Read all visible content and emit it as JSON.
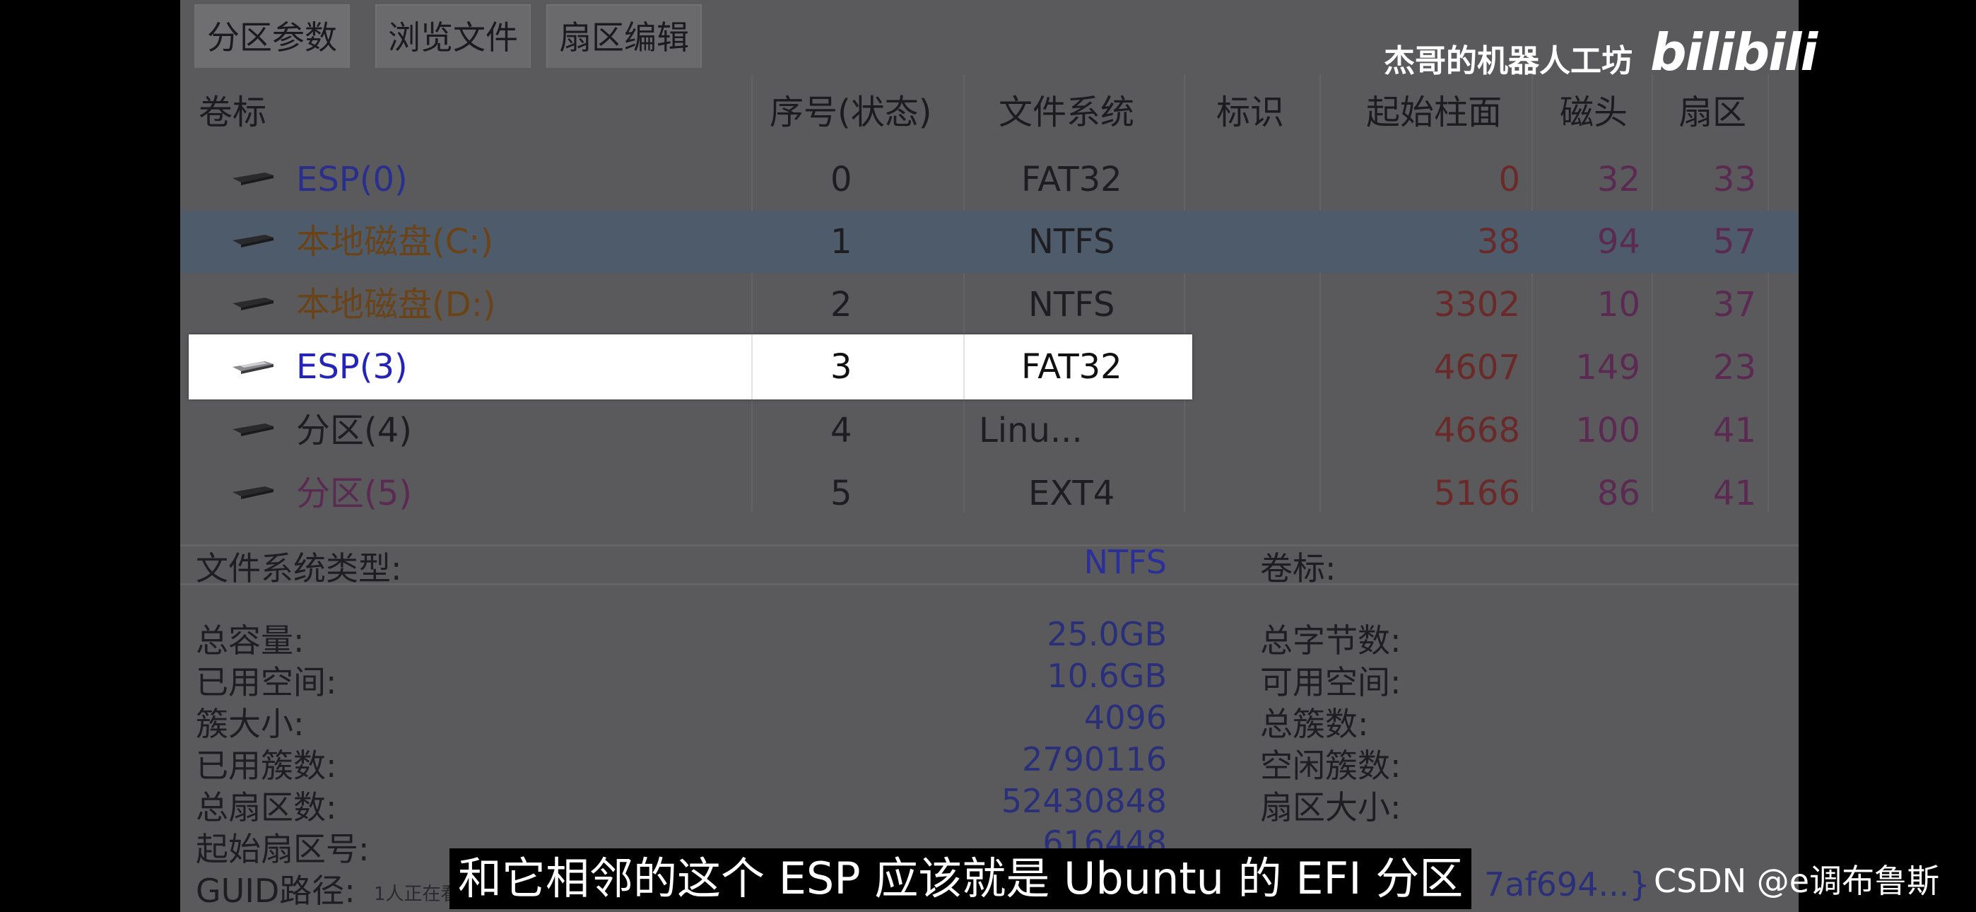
{
  "tabs": [
    {
      "label": "分区参数"
    },
    {
      "label": "浏览文件"
    },
    {
      "label": "扇区编辑"
    }
  ],
  "columns": {
    "label": "卷标",
    "index": "序号(状态)",
    "fs": "文件系统",
    "id": "标识",
    "cyl": "起始柱面",
    "head": "磁头",
    "sector": "扇区"
  },
  "partitions": [
    {
      "label": "ESP(0)",
      "index": "0",
      "fs": "FAT32",
      "cyl": "0",
      "head": "32",
      "sector": "33"
    },
    {
      "label": "本地磁盘(C:)",
      "index": "1",
      "fs": "NTFS",
      "cyl": "38",
      "head": "94",
      "sector": "57"
    },
    {
      "label": "本地磁盘(D:)",
      "index": "2",
      "fs": "NTFS",
      "cyl": "3302",
      "head": "10",
      "sector": "37"
    },
    {
      "label": "ESP(3)",
      "index": "3",
      "fs": "FAT32",
      "cyl": "4607",
      "head": "149",
      "sector": "23"
    },
    {
      "label": "分区(4)",
      "index": "4",
      "fs": "Linu...",
      "cyl": "4668",
      "head": "100",
      "sector": "41"
    },
    {
      "label": "分区(5)",
      "index": "5",
      "fs": "EXT4",
      "cyl": "5166",
      "head": "86",
      "sector": "41"
    }
  ],
  "info": {
    "fs_type_label": "文件系统类型:",
    "fs_type_value": "NTFS",
    "volume_label": "卷标:",
    "left": [
      {
        "label": "总容量:",
        "value": "25.0GB"
      },
      {
        "label": "已用空间:",
        "value": "10.6GB"
      },
      {
        "label": "簇大小:",
        "value": "4096"
      },
      {
        "label": "已用簇数:",
        "value": "2790116"
      },
      {
        "label": "总扇区数:",
        "value": "52430848"
      },
      {
        "label": "起始扇区号:",
        "value": "616448"
      },
      {
        "label": "GUID路径:",
        "value": ""
      }
    ],
    "right": [
      {
        "label": "总字节数:"
      },
      {
        "label": "可用空间:"
      },
      {
        "label": "总簇数:"
      },
      {
        "label": "空闲簇数:"
      },
      {
        "label": "扇区大小:"
      }
    ],
    "guid_tail": "7af694...}"
  },
  "overlay": {
    "watermark": "杰哥的机器人工坊",
    "bili_logo": "bilibili",
    "subtitle": "和它相邻的这个 ESP 应该就是 Ubuntu 的 EFI 分区",
    "csdn": "CSDN @e调布鲁斯",
    "viewers": "1人正在看"
  },
  "colors": {
    "selected_row": "#4e5b6a",
    "highlight": "#ffffff",
    "esp_label": "#2b2f8c",
    "ntfs_label": "#6a4418",
    "linux_label": "#5a2a52"
  }
}
